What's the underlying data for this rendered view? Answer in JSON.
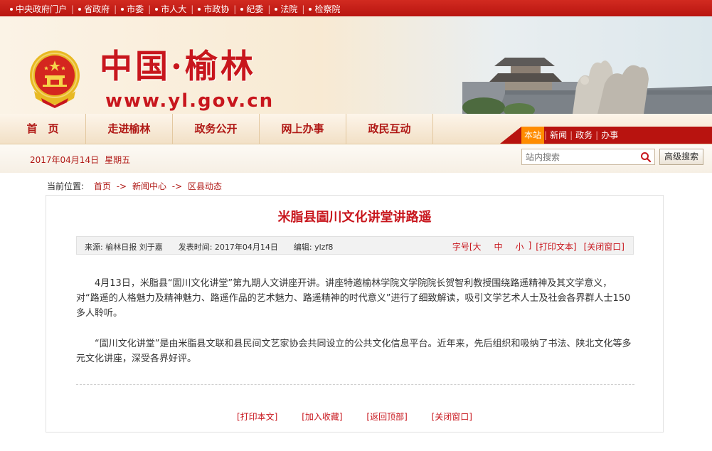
{
  "top_links": [
    "中央政府门户",
    "省政府",
    "市委",
    "市人大",
    "市政协",
    "纪委",
    "法院",
    "检察院"
  ],
  "banner": {
    "title": "中国·榆林",
    "url": "www.yl.gov.cn"
  },
  "nav": {
    "items": [
      "首　页",
      "走进榆林",
      "政务公开",
      "网上办事",
      "政民互动"
    ],
    "sublinks": [
      "本站",
      "新闻",
      "政务",
      "办事"
    ]
  },
  "date": {
    "date": "2017年04月14日",
    "weekday": "星期五"
  },
  "search": {
    "placeholder": "站内搜索",
    "advanced_label": "高级搜索"
  },
  "breadcrumb": {
    "prefix": "当前位置:",
    "items": [
      "首页",
      "新闻中心",
      "区县动态"
    ],
    "separator": "->"
  },
  "article": {
    "title": "米脂县圁川文化讲堂讲路遥",
    "source": "来源: 榆林日报 刘于嘉",
    "published": "发表时间: 2017年04月14日",
    "editor": "编辑: ylzf8",
    "font_size_label": "字号[",
    "font_large": "大",
    "font_medium": "中",
    "font_small": "小",
    "font_close": "]",
    "print_text": "[打印文本]",
    "close_window": "[关闭窗口]",
    "paragraphs": [
      "4月13日，米脂县“圁川文化讲堂”第九期人文讲座开讲。讲座特邀榆林学院文学院院长贺智利教授围绕路遥精神及其文学意义，对“路遥的人格魅力及精神魅力、路遥作品的艺术魅力、路遥精神的时代意义”进行了细致解读，吸引文学艺术人士及社会各界群人士150多人聆听。",
      "“圁川文化讲堂”是由米脂县文联和县民间文艺家协会共同设立的公共文化信息平台。近年来，先后组织和吸纳了书法、陕北文化等多元文化讲座，深受各界好评。"
    ],
    "bottom_links": [
      "[打印本文]",
      "[加入收藏]",
      "[返回顶部]",
      "[关闭窗口]"
    ]
  },
  "colors": {
    "brand_red": "#c8161d",
    "nav_red": "#b8130f",
    "active_orange": "#ff8c00"
  },
  "icons": [
    "national-emblem-icon",
    "search-icon",
    "bullet-dot-icon"
  ]
}
